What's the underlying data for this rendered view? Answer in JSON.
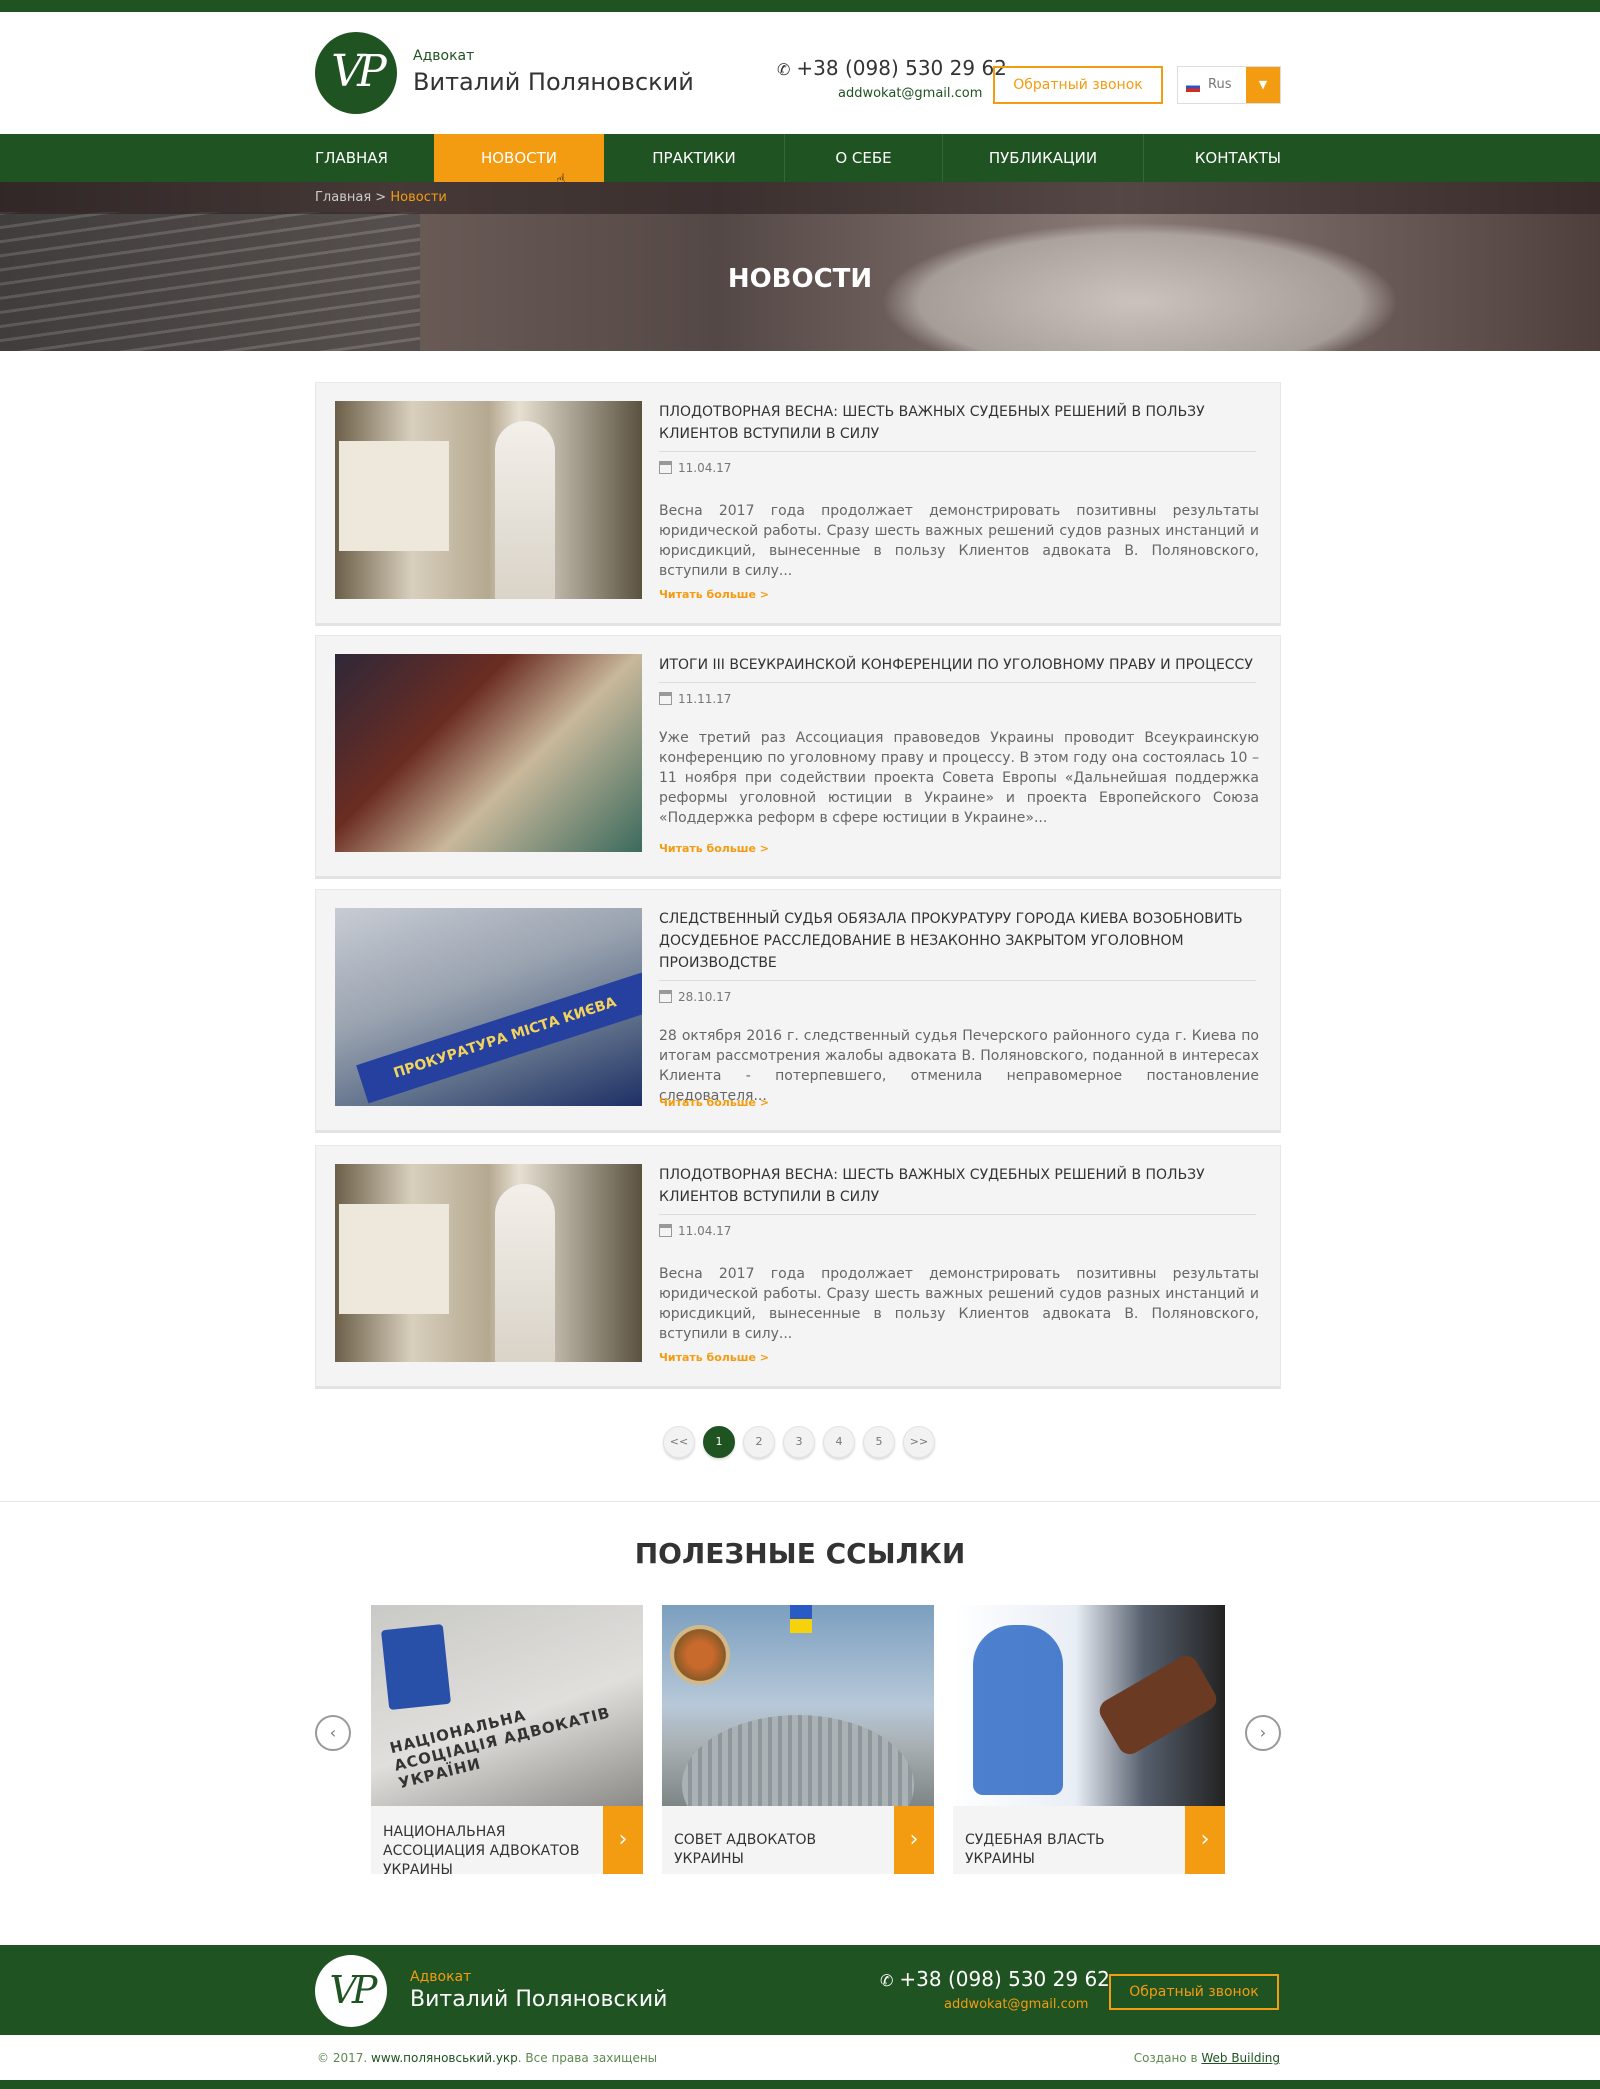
{
  "header": {
    "logo_text": "VP",
    "brand_small": "Адвокат",
    "brand_name": "Виталий Поляновский",
    "phone": "+38 (098) 530 29 62",
    "email": "addwokat@gmail.com",
    "callback_label": "Обратный звонок",
    "language": "Rus"
  },
  "nav": {
    "items": [
      {
        "label": "ГЛАВНАЯ"
      },
      {
        "label": "НОВОСТИ",
        "active": true
      },
      {
        "label": "ПРАКТИКИ"
      },
      {
        "label": "О СЕБЕ"
      },
      {
        "label": "ПУБЛИКАЦИИ"
      },
      {
        "label": "КОНТАКТЫ"
      }
    ]
  },
  "breadcrumb": {
    "home": "Главная",
    "separator": ">",
    "current": "Новости"
  },
  "page_title": "НОВОСТИ",
  "news": [
    {
      "title": "ПЛОДОТВОРНАЯ ВЕСНА: ШЕСТЬ ВАЖНЫХ СУДЕБНЫХ РЕШЕНИЙ В ПОЛЬЗУ КЛИЕНТОВ ВСТУПИЛИ В СИЛУ",
      "date": "11.04.17",
      "text": "Весна 2017 года продолжает демонстрировать позитивны результаты юридической работы. Сразу шесть важных решений судов разных инстанций и юрисдикций, вынесенные в пользу Клиентов адвоката В. Поляновского, вступили в силу...",
      "more": "Читать больше >"
    },
    {
      "title": "ИТОГИ III ВСЕУКРАИНСКОЙ КОНФЕРЕНЦИИ ПО УГОЛОВНОМУ ПРАВУ И ПРОЦЕССУ",
      "date": "11.11.17",
      "text": "Уже третий раз Ассоциация правоведов Украины проводит Всеукраинскую конференцию по уголовному праву и процессу. В этом году она состоялась 10 – 11 ноября при содействии проекта Совета Европы «Дальнейшая поддержка реформы уголовной юстиции в Украине» и проекта Европейского Союза «Поддержка реформ в сфере юстиции в Украине»...",
      "more": "Читать больше >"
    },
    {
      "title": "СЛЕДСТВЕННЫЙ СУДЬЯ ОБЯЗАЛА ПРОКУРАТУРУ ГОРОДА КИЕВА ВОЗОБНОВИТЬ ДОСУДЕБНОЕ РАССЛЕДОВАНИЕ В НЕЗАКОННО ЗАКРЫТОМ УГОЛОВНОМ ПРОИЗВОДСТВЕ",
      "date": "28.10.17",
      "text": "28 октября 2016 г. следственный судья Печерского районного суда г. Киева по итогам рассмотрения жалобы адвоката В. Поляновского, поданной в интересах Клиента - потерпевшего, отменила неправомерное постановление следователя...",
      "more": "Читать больше >",
      "image_caption": "ПРОКУРАТУРА МІСТА КИЄВА"
    },
    {
      "title": "ПЛОДОТВОРНАЯ ВЕСНА: ШЕСТЬ ВАЖНЫХ СУДЕБНЫХ РЕШЕНИЙ В ПОЛЬЗУ КЛИЕНТОВ ВСТУПИЛИ В СИЛУ",
      "date": "11.04.17",
      "text": "Весна 2017 года продолжает демонстрировать позитивны результаты юридической работы. Сразу шесть важных решений судов разных инстанций и юрисдикций, вынесенные в пользу Клиентов адвоката В. Поляновского, вступили в силу...",
      "more": "Читать больше >"
    }
  ],
  "pagination": {
    "prev": "<<",
    "pages": [
      "1",
      "2",
      "3",
      "4",
      "5"
    ],
    "current": "1",
    "next": ">>"
  },
  "useful_links": {
    "title": "ПОЛЕЗНЫЕ ССЫЛКИ",
    "prev_arrow": "‹",
    "next_arrow": "›",
    "cards": [
      {
        "label": "НАЦИОНАЛЬНАЯ АССОЦИАЦИЯ АДВОКАТОВ УКРАИНЫ",
        "image_text": "НАЦІОНАЛЬНА АСОЦІАЦІЯ АДВОКАТІВ УКРАЇНИ"
      },
      {
        "label": "СОВЕТ АДВОКАТОВ УКРАИНЫ"
      },
      {
        "label": "СУДЕБНАЯ ВЛАСТЬ УКРАИНЫ"
      }
    ]
  },
  "footer": {
    "logo_text": "VP",
    "brand_small": "Адвокат",
    "brand_name": "Виталий Поляновский",
    "phone": "+38 (098) 530 29 62",
    "email": "addwokat@gmail.com",
    "callback_label": "Обратный звонок",
    "copyright_prefix": "© 2017.",
    "site": "www.поляновський.укр",
    "copyright_suffix": ". Все права захищены",
    "made_by_prefix": "Создано в",
    "made_by": "Web Building"
  },
  "colors": {
    "brand_green": "#1f5321",
    "accent_orange": "#f39c12"
  },
  "icons": [
    "phone-icon",
    "flag-ru-icon",
    "dropdown-arrow-icon",
    "calendar-icon",
    "chevron-right-icon",
    "chevron-left-icon",
    "cursor-icon"
  ]
}
